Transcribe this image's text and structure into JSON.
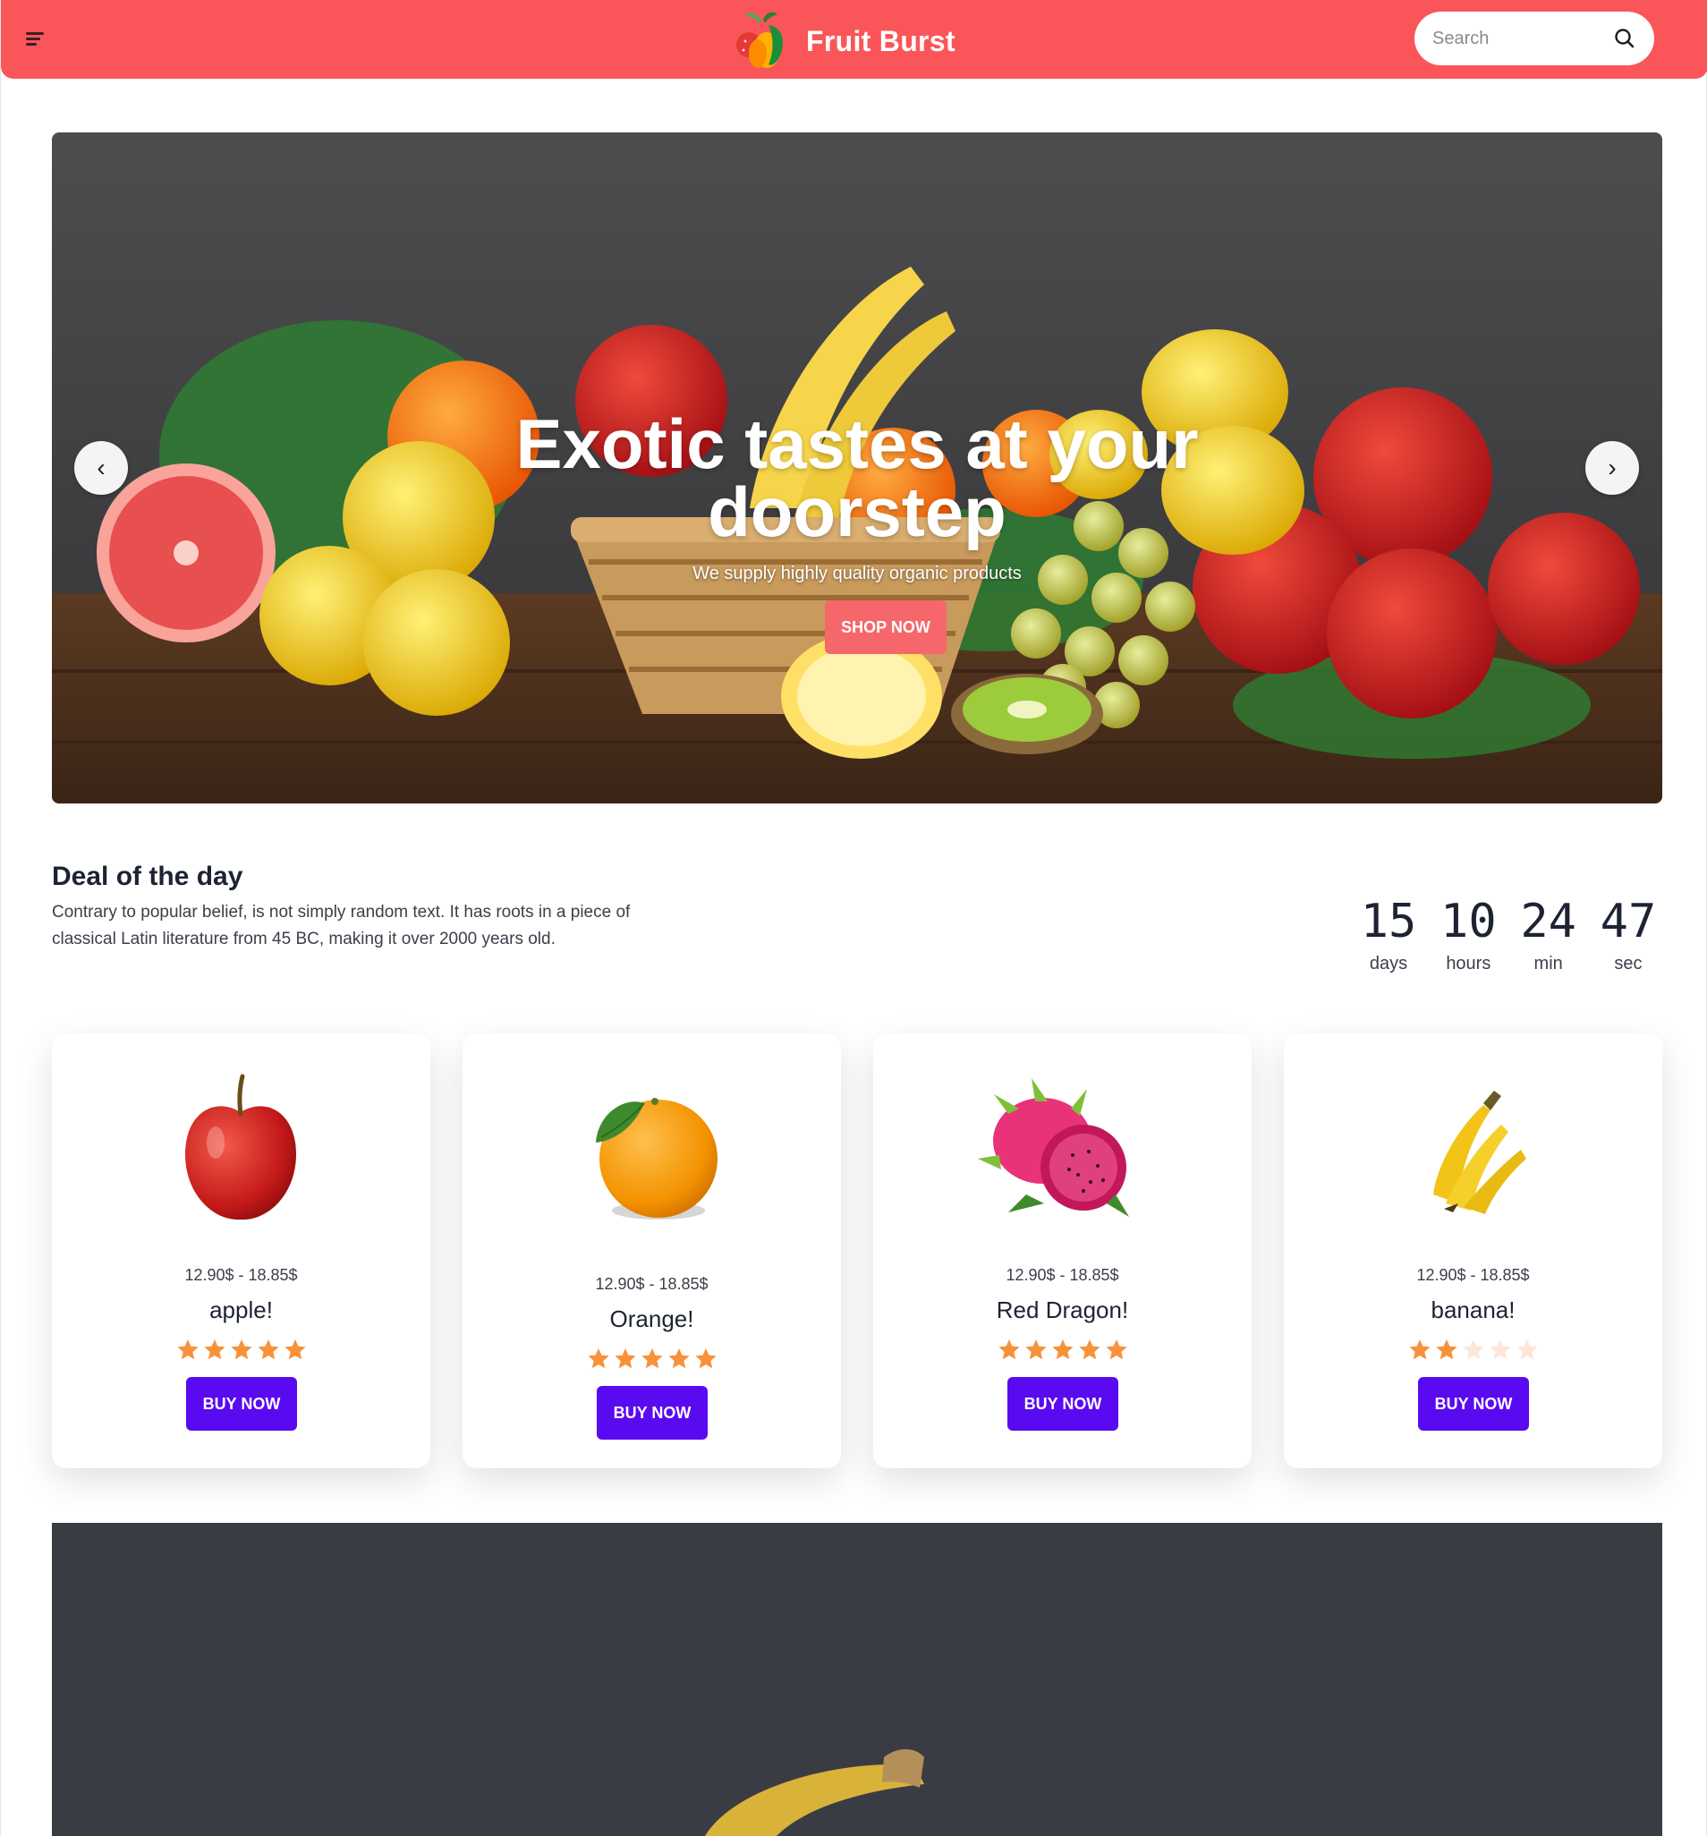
{
  "header": {
    "brand_name": "Fruit Burst",
    "search_placeholder": "Search",
    "colors": {
      "background": "#fa5659",
      "text": "#ffffff"
    }
  },
  "hero": {
    "title": "Exotic tastes at your doorstep",
    "subtitle": "We supply highly quality organic products",
    "cta_label": "SHOP NOW",
    "prev_label": "‹",
    "next_label": "›",
    "colors": {
      "cta": "#f5676a"
    }
  },
  "deal": {
    "title": "Deal of the day",
    "description": "Contrary to popular belief, is not simply random text. It has roots in a piece of classical Latin literature from 45 BC, making it over 2000 years old.",
    "countdown": [
      {
        "value": "15",
        "label": "days"
      },
      {
        "value": "10",
        "label": "hours"
      },
      {
        "value": "24",
        "label": "min"
      },
      {
        "value": "47",
        "label": "sec"
      }
    ]
  },
  "products": [
    {
      "image_icon": "apple-icon",
      "price": "12.90$ - 18.85$",
      "name": "apple!",
      "rating": 5,
      "max_rating": 5,
      "button_label": "BUY NOW"
    },
    {
      "image_icon": "orange-icon",
      "price": "12.90$ - 18.85$",
      "name": "Orange!",
      "rating": 5,
      "max_rating": 5,
      "button_label": "BUY NOW"
    },
    {
      "image_icon": "dragon-fruit-icon",
      "price": "12.90$ - 18.85$",
      "name": "Red Dragon!",
      "rating": 5,
      "max_rating": 5,
      "button_label": "BUY NOW"
    },
    {
      "image_icon": "banana-icon",
      "price": "12.90$ - 18.85$",
      "name": "banana!",
      "rating": 2,
      "max_rating": 5,
      "button_label": "BUY NOW"
    }
  ],
  "colors": {
    "accent_button": "#5a0af0",
    "star_filled": "#f7923a",
    "star_empty": "#fde6d8",
    "banner_dark": "#3a3c44"
  }
}
